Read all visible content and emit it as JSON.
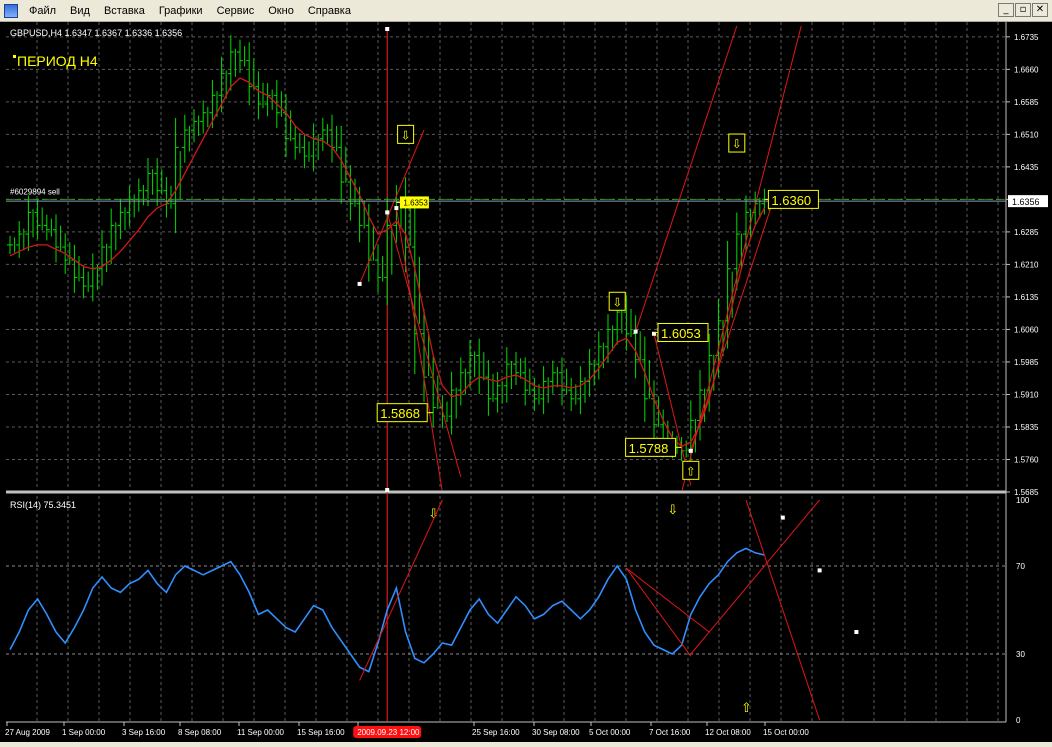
{
  "menu": {
    "items": [
      "Файл",
      "Вид",
      "Вставка",
      "Графики",
      "Сервис",
      "Окно",
      "Справка"
    ],
    "window_controls": [
      "_",
      "▫",
      "✕"
    ]
  },
  "main_chart": {
    "header": "GBPUSD,H4  1.6347 1.6367 1.6336 1.6356",
    "period_label": "ПЕРИОД H4",
    "order_label": "#6029894 sell",
    "current_price": "1.6356",
    "price_ticks": [
      "1.6735",
      "1.6660",
      "1.6585",
      "1.6510",
      "1.6435",
      "1.6360",
      "1.6285",
      "1.6210",
      "1.6135",
      "1.6060",
      "1.5985",
      "1.5910",
      "1.5835",
      "1.5760",
      "1.5685"
    ],
    "price_annotations": [
      {
        "text": "1.6353",
        "price": 1.6353,
        "x_index": 42
      },
      {
        "text": "1.5868",
        "price": 1.5868,
        "x_index": 46
      },
      {
        "text": "1.6053",
        "price": 1.6053,
        "x_index": 70
      },
      {
        "text": "1.5788",
        "price": 1.5788,
        "x_index": 73
      },
      {
        "text": "1.6360",
        "price": 1.636,
        "x_index": 82
      }
    ],
    "arrows": [
      {
        "dir": "down",
        "price": 1.651,
        "x_index": 43
      },
      {
        "dir": "down",
        "price": 1.6125,
        "x_index": 66
      },
      {
        "dir": "down",
        "price": 1.649,
        "x_index": 79
      },
      {
        "dir": "up",
        "price": 1.5735,
        "x_index": 74
      }
    ]
  },
  "rsi_panel": {
    "header": "RSI(14) 75.3451",
    "ticks": [
      "100",
      "70",
      "30",
      "0"
    ]
  },
  "x_axis": {
    "labels": [
      "27 Aug 2009",
      "1 Sep 00:00",
      "3 Sep 16:00",
      "8 Sep 08:00",
      "11 Sep 00:00",
      "15 Sep 16:00",
      "18 Sep 0",
      "25 Sep 16:00",
      "30 Sep 08:00",
      "5 Oct 00:00",
      "7 Oct 16:00",
      "12 Oct 08:00",
      "15 Oct 00:00"
    ],
    "highlight_label": "2009.09.23 12:00"
  },
  "chart_data": {
    "type": "bar",
    "symbol": "GBPUSD",
    "timeframe": "H4",
    "price_range": [
      1.5685,
      1.676
    ],
    "rsi_range": [
      0,
      100
    ],
    "last_price": 1.6356,
    "close": [
      1.6255,
      1.628,
      1.633,
      1.63,
      1.629,
      1.625,
      1.622,
      1.618,
      1.616,
      1.62,
      1.625,
      1.63,
      1.633,
      1.636,
      1.638,
      1.642,
      1.638,
      1.635,
      1.648,
      1.652,
      1.654,
      1.656,
      1.66,
      1.665,
      1.67,
      1.668,
      1.662,
      1.658,
      1.66,
      1.656,
      1.65,
      1.648,
      1.646,
      1.65,
      1.652,
      1.648,
      1.64,
      1.635,
      1.63,
      1.622,
      1.618,
      1.63,
      1.6353,
      1.625,
      1.605,
      1.595,
      1.588,
      1.586,
      1.592,
      1.596,
      1.6,
      1.595,
      1.59,
      1.593,
      1.598,
      1.596,
      1.592,
      1.59,
      1.594,
      1.596,
      1.592,
      1.59,
      1.594,
      1.598,
      1.602,
      1.606,
      1.61,
      1.605,
      1.599,
      1.59,
      1.584,
      1.58,
      1.5788,
      1.578,
      1.585,
      1.592,
      1.6,
      1.608,
      1.62,
      1.628,
      1.633,
      1.635,
      1.636
    ],
    "ma": [
      1.623,
      1.624,
      1.625,
      1.6255,
      1.6255,
      1.6245,
      1.6235,
      1.622,
      1.6205,
      1.62,
      1.6205,
      1.622,
      1.624,
      1.6265,
      1.629,
      1.632,
      1.634,
      1.635,
      1.638,
      1.642,
      1.646,
      1.65,
      1.654,
      1.658,
      1.662,
      1.664,
      1.663,
      1.661,
      1.66,
      1.658,
      1.656,
      1.653,
      1.651,
      1.65,
      1.6495,
      1.648,
      1.645,
      1.641,
      1.637,
      1.632,
      1.628,
      1.629,
      1.631,
      1.628,
      1.62,
      1.61,
      1.6,
      1.593,
      1.5905,
      1.591,
      1.5935,
      1.595,
      1.5945,
      1.594,
      1.595,
      1.5955,
      1.5945,
      1.593,
      1.5925,
      1.593,
      1.593,
      1.5925,
      1.593,
      1.5945,
      1.597,
      1.6,
      1.603,
      1.604,
      1.601,
      1.596,
      1.59,
      1.585,
      1.581,
      1.579,
      1.58,
      1.584,
      1.59,
      1.598,
      1.607,
      1.616,
      1.624,
      1.63,
      1.634
    ],
    "rsi": [
      32,
      40,
      50,
      55,
      48,
      40,
      35,
      42,
      50,
      60,
      65,
      60,
      58,
      62,
      64,
      68,
      62,
      58,
      66,
      70,
      68,
      66,
      68,
      70,
      72,
      66,
      58,
      48,
      50,
      46,
      42,
      40,
      46,
      52,
      50,
      42,
      36,
      30,
      24,
      22,
      35,
      50,
      60,
      40,
      28,
      26,
      30,
      35,
      34,
      42,
      50,
      55,
      48,
      44,
      50,
      56,
      52,
      46,
      48,
      52,
      54,
      50,
      46,
      50,
      56,
      64,
      70,
      64,
      50,
      40,
      34,
      32,
      30,
      34,
      48,
      56,
      62,
      66,
      72,
      76,
      78,
      76,
      75
    ],
    "highlight_index": 41,
    "trendlines_price": [
      {
        "a": [
          38,
          1.6165
        ],
        "b": [
          45,
          1.652
        ]
      },
      {
        "a": [
          42,
          1.634
        ],
        "b": [
          47,
          1.5685
        ]
      },
      {
        "a": [
          41,
          1.633
        ],
        "b": [
          49,
          1.572
        ]
      },
      {
        "a": [
          68,
          1.6055
        ],
        "b": [
          79,
          1.676
        ]
      },
      {
        "a": [
          73,
          1.5685
        ],
        "b": [
          86,
          1.676
        ]
      },
      {
        "a": [
          70,
          1.605
        ],
        "b": [
          74,
          1.57
        ]
      },
      {
        "a": [
          74,
          1.578
        ],
        "b": [
          83,
          1.636
        ]
      }
    ],
    "trendlines_rsi": [
      {
        "a": [
          38,
          18
        ],
        "b": [
          47,
          100
        ]
      },
      {
        "a": [
          67,
          69
        ],
        "b": [
          74,
          29
        ]
      },
      {
        "a": [
          67,
          69
        ],
        "b": [
          76,
          40
        ]
      },
      {
        "a": [
          74,
          30
        ],
        "b": [
          88,
          100
        ]
      },
      {
        "a": [
          80,
          100
        ],
        "b": [
          88,
          0
        ]
      }
    ]
  }
}
